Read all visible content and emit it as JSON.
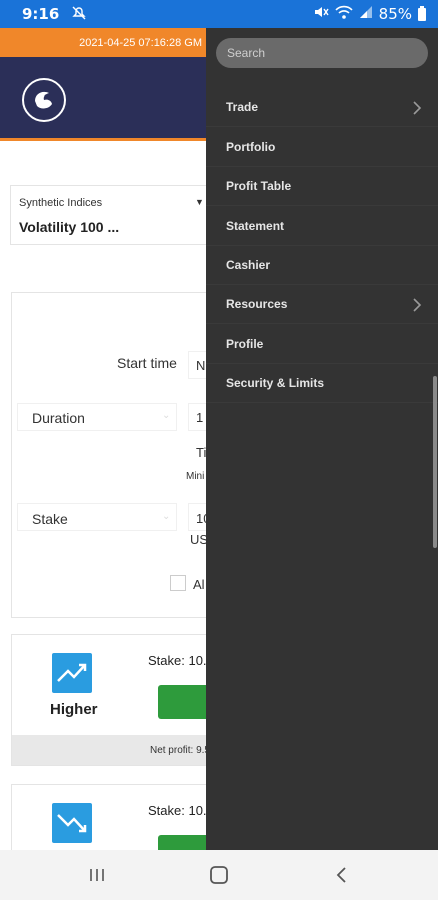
{
  "status_bar": {
    "time": "9:16",
    "battery": "85%",
    "icons": [
      "notification-off-icon",
      "mute-icon",
      "wifi-icon",
      "signal-icon",
      "battery-icon"
    ]
  },
  "top_bar": {
    "timestamp": "2021-04-25 07:16:28 GM"
  },
  "market": {
    "category": "Synthetic Indices",
    "symbol": "Volatility 100 ..."
  },
  "form": {
    "start_time_label": "Start time",
    "start_time_value": "N",
    "duration_label": "Duration",
    "duration_value": "1",
    "duration_unit": "Ti",
    "duration_hint": "Mini",
    "stake_label": "Stake",
    "stake_value": "10",
    "stake_currency": "US",
    "checkbox_label": "Al"
  },
  "contracts": [
    {
      "label": "Higher",
      "stake_text": "Stake: 10.",
      "net_profit": "Net profit: 9.5"
    },
    {
      "label": "",
      "stake_text": "Stake: 10."
    }
  ],
  "drawer": {
    "search_placeholder": "Search",
    "items": [
      {
        "label": "Trade",
        "has_submenu": true
      },
      {
        "label": "Portfolio",
        "has_submenu": false
      },
      {
        "label": "Profit Table",
        "has_submenu": false
      },
      {
        "label": "Statement",
        "has_submenu": false
      },
      {
        "label": "Cashier",
        "has_submenu": false
      },
      {
        "label": "Resources",
        "has_submenu": true
      },
      {
        "label": "Profile",
        "has_submenu": false
      },
      {
        "label": "Security & Limits",
        "has_submenu": false
      }
    ]
  },
  "colors": {
    "status_bar": "#1a73d8",
    "accent_orange": "#f0872a",
    "header_navy": "#2b2f58",
    "drawer_bg": "#333333",
    "buy_green": "#2e9b3c",
    "tile_blue": "#2a9ce0"
  },
  "nav_bar": {
    "icons": [
      "recent-apps-icon",
      "home-icon",
      "back-icon"
    ]
  }
}
